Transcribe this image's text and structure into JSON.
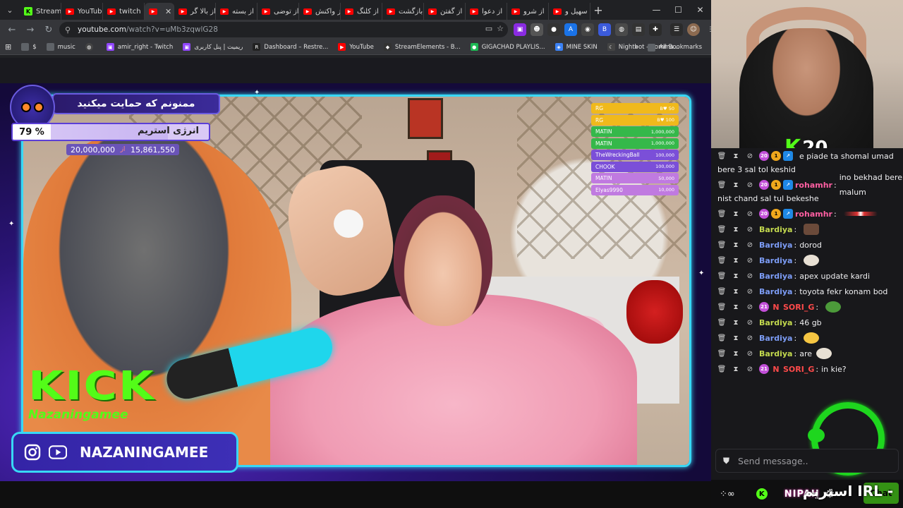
{
  "browser": {
    "tabs": [
      {
        "label": "Stream",
        "icon": "kick"
      },
      {
        "label": "YouTub",
        "icon": "youtube"
      },
      {
        "label": "twitch",
        "icon": "youtube"
      },
      {
        "label": "",
        "icon": "youtube",
        "active": true
      },
      {
        "label": "از بالا گر",
        "icon": "youtube"
      },
      {
        "label": "از بسته",
        "icon": "youtube"
      },
      {
        "label": "از توضی",
        "icon": "youtube"
      },
      {
        "label": "از واکنش",
        "icon": "youtube"
      },
      {
        "label": "از کلنگ",
        "icon": "youtube"
      },
      {
        "label": "از بازگشت",
        "icon": "youtube"
      },
      {
        "label": "از گفتن",
        "icon": "youtube"
      },
      {
        "label": "از دعوا",
        "icon": "youtube"
      },
      {
        "label": "از شرو",
        "icon": "youtube"
      },
      {
        "label": "سهیل و",
        "icon": "youtube"
      }
    ],
    "url_host": "youtube.com",
    "url_path": "/watch?v=uMb3zqwlG28",
    "bookmarks": [
      {
        "label": "$",
        "icon": "folder"
      },
      {
        "label": "music",
        "icon": "folder"
      },
      {
        "label": "",
        "icon": "globe"
      },
      {
        "label": "amir_right - Twitch",
        "icon": "twitch"
      },
      {
        "label": "ریمیت | پنل کاربری",
        "icon": "twitch"
      },
      {
        "label": "Dashboard – Restre...",
        "icon": "restream"
      },
      {
        "label": "YouTube",
        "icon": "youtube"
      },
      {
        "label": "StreamElements - B...",
        "icon": "streamelements"
      },
      {
        "label": "GIGACHAD PLAYLIS...",
        "icon": "spotify"
      },
      {
        "label": "MINE SKIN",
        "icon": "mineskin"
      },
      {
        "label": "Nightbot - Comma...",
        "icon": "nightbot"
      }
    ],
    "all_bookmarks": "All Bookmarks"
  },
  "overlay": {
    "support_text": "ممنونم که حمایت میکنید",
    "energy_percent": "79 %",
    "energy_fraction": 0.79,
    "energy_label": "انرژی استریم",
    "goal_target": "20,000,000",
    "goal_of": "از",
    "goal_current": "15,861,550",
    "donations": [
      {
        "name": "RG",
        "amount": "B♥ 50",
        "color": "#f0b91c"
      },
      {
        "name": "RG",
        "amount": "B♥ 100",
        "color": "#f0b91c"
      },
      {
        "name": "MATIN",
        "amount": "1,000,000",
        "color": "#35b84a"
      },
      {
        "name": "MATIN",
        "amount": "1,000,000",
        "color": "#35b84a"
      },
      {
        "name": "TheWreckingBall",
        "amount": "100,000",
        "color": "#7b4fd8"
      },
      {
        "name": "CHOOK",
        "amount": "100,000",
        "color": "#7b4fd8"
      },
      {
        "name": "MATIN",
        "amount": "50,000",
        "color": "#c07ae0"
      },
      {
        "name": "Elyas9990",
        "amount": "10,000",
        "color": "#c07ae0"
      }
    ],
    "kick_logo_text": "KICK",
    "kick_username": "Nazaningamee",
    "socials_name": "NAZANINGAMEE"
  },
  "webcam": {
    "kick_count": "20"
  },
  "chat": {
    "messages": [
      {
        "badges": [
          "20",
          "1",
          "arrow"
        ],
        "user": "",
        "user_color": "#53fc18",
        "text": "e piade ta shomal umad bere 3 sal tol keshid",
        "emote": null
      },
      {
        "badges": [
          "20",
          "1",
          "arrow"
        ],
        "user": "rohamhr",
        "user_color": "#ff5fa2",
        "text": "ino bekhad bere malum nist chand sal tul bekeshe",
        "emote": null
      },
      {
        "badges": [
          "20",
          "1",
          "arrow"
        ],
        "user": "rohamhr",
        "user_color": "#ff5fa2",
        "text": "",
        "emote": "line"
      },
      {
        "badges": [],
        "user": "Bardiya",
        "user_color": "#c3d94e",
        "text": "",
        "emote": "face"
      },
      {
        "badges": [],
        "user": "Bardiya",
        "user_color": "#7c9cf5",
        "text": "dorod",
        "emote": null
      },
      {
        "badges": [],
        "user": "Bardiya",
        "user_color": "#7c9cf5",
        "text": "",
        "emote": "cat"
      },
      {
        "badges": [],
        "user": "Bardiya",
        "user_color": "#7c9cf5",
        "text": "apex update kardi",
        "emote": null
      },
      {
        "badges": [],
        "user": "Bardiya",
        "user_color": "#7c9cf5",
        "text": "toyota fekr konam bod",
        "emote": null
      },
      {
        "badges": [
          "21",
          "N"
        ],
        "user": "SORI_G",
        "user_color": "#ff4a4a",
        "text": "",
        "emote": "pepe"
      },
      {
        "badges": [],
        "user": "Bardiya",
        "user_color": "#c3d94e",
        "text": "46 gb",
        "emote": null
      },
      {
        "badges": [],
        "user": "Bardiya",
        "user_color": "#7c9cf5",
        "text": "",
        "emote": "duck"
      },
      {
        "badges": [],
        "user": "Bardiya",
        "user_color": "#c3d94e",
        "text": "are",
        "emote": "cat"
      },
      {
        "badges": [
          "21",
          "N"
        ],
        "user": "SORI_G",
        "user_color": "#ff4a4a",
        "text": "in kie?",
        "emote": null
      }
    ],
    "placeholder": "Send message..",
    "chat_button": "Chat"
  },
  "footer": {
    "nipah": "NIPAH",
    "irl_text": "استریم IRL -"
  },
  "colors": {
    "kick_green": "#53fc18",
    "overlay_cyan": "#38d8f5",
    "overlay_purple": "#3424a6"
  }
}
